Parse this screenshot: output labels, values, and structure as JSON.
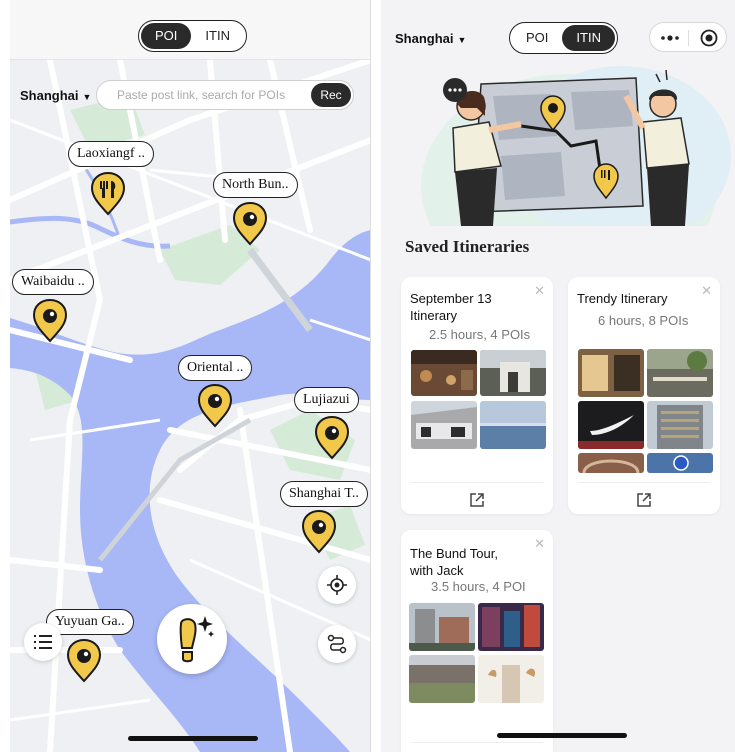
{
  "left": {
    "tabs": [
      "POI",
      "ITIN"
    ],
    "active_tab": "POI",
    "city": "Shanghai",
    "search": {
      "placeholder": "Paste post link, search for POIs",
      "button": "Rec"
    },
    "pois": [
      {
        "label": "Laoxiangf ..",
        "icon": "fork-knife-icon"
      },
      {
        "label": "North Bun..",
        "icon": "eye-icon"
      },
      {
        "label": "Waibaidu ..",
        "icon": "eye-icon"
      },
      {
        "label": "Oriental ..",
        "icon": "eye-icon"
      },
      {
        "label": "Lujiazui",
        "icon": "eye-icon"
      },
      {
        "label": "Shanghai T..",
        "icon": "eye-icon"
      },
      {
        "label": "Yuyuan Ga..",
        "icon": "eye-icon"
      }
    ],
    "controls": [
      "list-icon",
      "footprint-sparkle-icon",
      "locate-icon",
      "route-icon"
    ]
  },
  "right": {
    "city": "Shanghai",
    "tabs": [
      "POI",
      "ITIN"
    ],
    "active_tab": "ITIN",
    "capsule": [
      "more-icon",
      "target-icon"
    ],
    "section_title": "Saved Itineraries",
    "cards": [
      {
        "title": "September 13 Itinerary",
        "meta": "2.5 hours,  4 POIs",
        "thumb_colors": [
          "#6a4a34",
          "#5b5f55",
          "#a9a9ab",
          "#5b7fa6"
        ]
      },
      {
        "title": "Trendy Itinerary",
        "meta": "6 hours,  8 POIs",
        "thumb_colors": [
          "#7d6142",
          "#6c6b5f",
          "#1c1c1e",
          "#7f8589",
          "#8a5f49",
          "#4c74a8"
        ]
      },
      {
        "title": "The Bund Tour, with Jack",
        "meta": "3.5 hours,  4 POI",
        "thumb_colors": [
          "#8b8d8f",
          "#7d3f5e",
          "#7e8a60",
          "#d6c7b5"
        ]
      }
    ]
  },
  "colors": {
    "pin": "#f2c84b",
    "water": "#a7b8f5",
    "park": "#d7ecd9",
    "dark": "#2a2a2a"
  }
}
